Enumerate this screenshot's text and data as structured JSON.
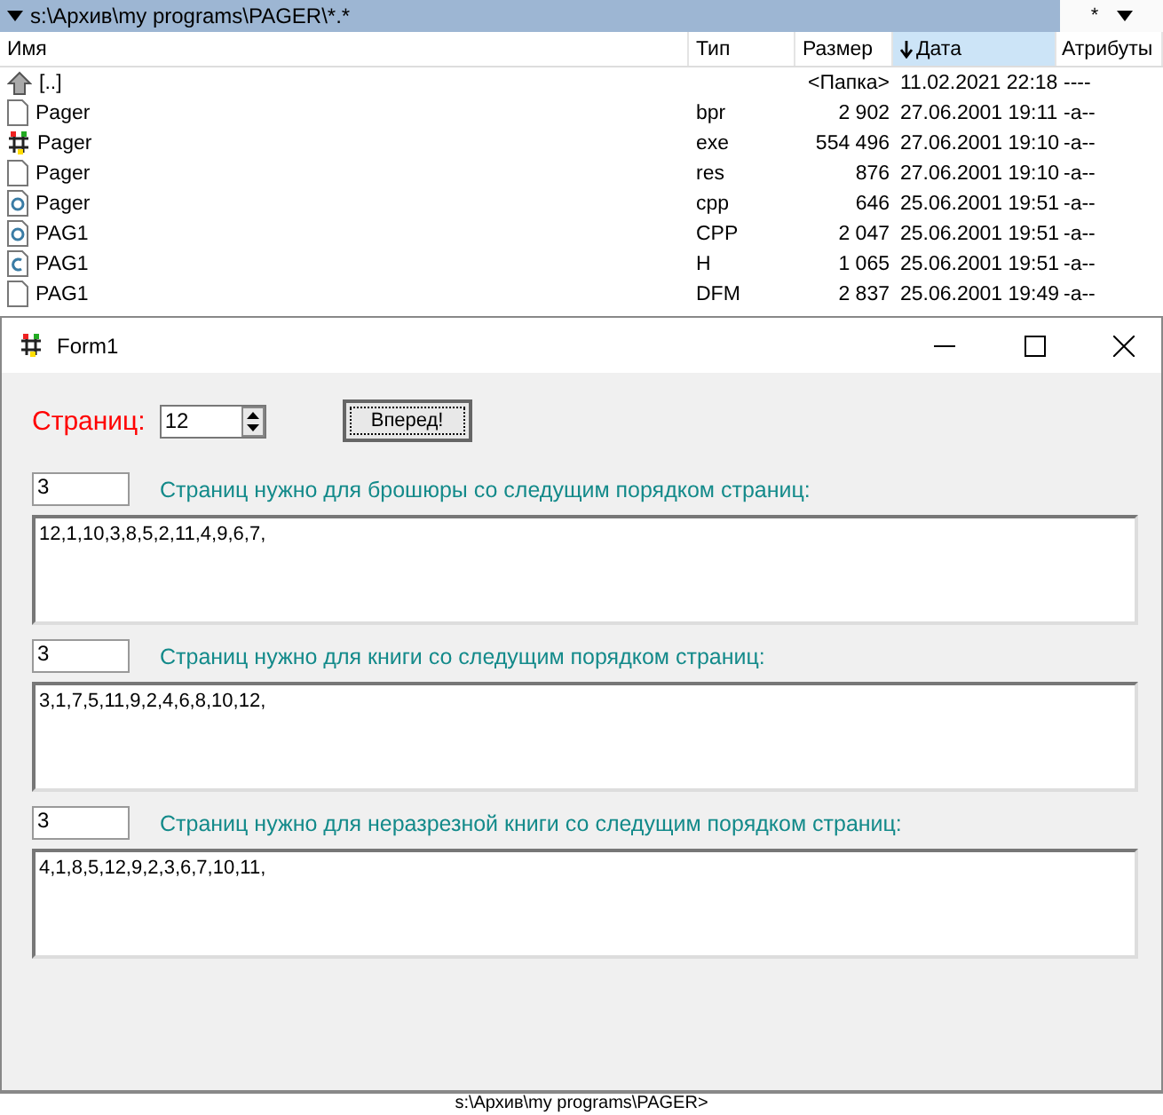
{
  "file_panel": {
    "path": "s:\\Архив\\my programs\\PAGER\\*.*",
    "menu_glyph": "*",
    "columns": [
      {
        "label": "Имя",
        "sorted": false
      },
      {
        "label": "Тип",
        "sorted": false
      },
      {
        "label": "Размер",
        "sorted": false
      },
      {
        "label": "Дата",
        "sorted": true
      },
      {
        "label": "Атрибуты",
        "sorted": false
      }
    ],
    "rows": [
      {
        "kind": "up",
        "name": "[..]",
        "type": "",
        "size": "<Папка>",
        "date": "11.02.2021 22:18",
        "attributes": "----"
      },
      {
        "kind": "file",
        "name": "Pager",
        "type": "bpr",
        "size": "2 902",
        "date": "27.06.2001 19:11",
        "attributes": "-a--"
      },
      {
        "kind": "exe",
        "name": "Pager",
        "type": "exe",
        "size": "554 496",
        "date": "27.06.2001 19:10",
        "attributes": "-a--"
      },
      {
        "kind": "file",
        "name": "Pager",
        "type": "res",
        "size": "876",
        "date": "27.06.2001 19:10",
        "attributes": "-a--"
      },
      {
        "kind": "cpp",
        "name": "Pager",
        "type": "cpp",
        "size": "646",
        "date": "25.06.2001 19:51",
        "attributes": "-a--"
      },
      {
        "kind": "cpp",
        "name": "PAG1",
        "type": "CPP",
        "size": "2 047",
        "date": "25.06.2001 19:51",
        "attributes": "-a--"
      },
      {
        "kind": "h",
        "name": "PAG1",
        "type": "H",
        "size": "1 065",
        "date": "25.06.2001 19:51",
        "attributes": "-a--"
      },
      {
        "kind": "file",
        "name": "PAG1",
        "type": "DFM",
        "size": "2 837",
        "date": "25.06.2001 19:49",
        "attributes": "-a--"
      }
    ]
  },
  "window": {
    "title": "Form1",
    "pages_label": "Страниц:",
    "pages_value": "12",
    "button": "Вперед!",
    "sections": [
      {
        "count": "3",
        "label": "Страниц нужно для брошюры со следущим порядком страниц:",
        "order": "12,1,10,3,8,5,2,11,4,9,6,7,"
      },
      {
        "count": "3",
        "label": "Страниц нужно для книги со следущим порядком страниц:",
        "order": "3,1,7,5,11,9,2,4,6,8,10,12,"
      },
      {
        "count": "3",
        "label": "Страниц нужно для неразрезной книги со следущим порядком страниц:",
        "order": "4,1,8,5,12,9,2,3,6,7,10,11,"
      }
    ]
  },
  "command_line": "s:\\Архив\\my programs\\PAGER>"
}
